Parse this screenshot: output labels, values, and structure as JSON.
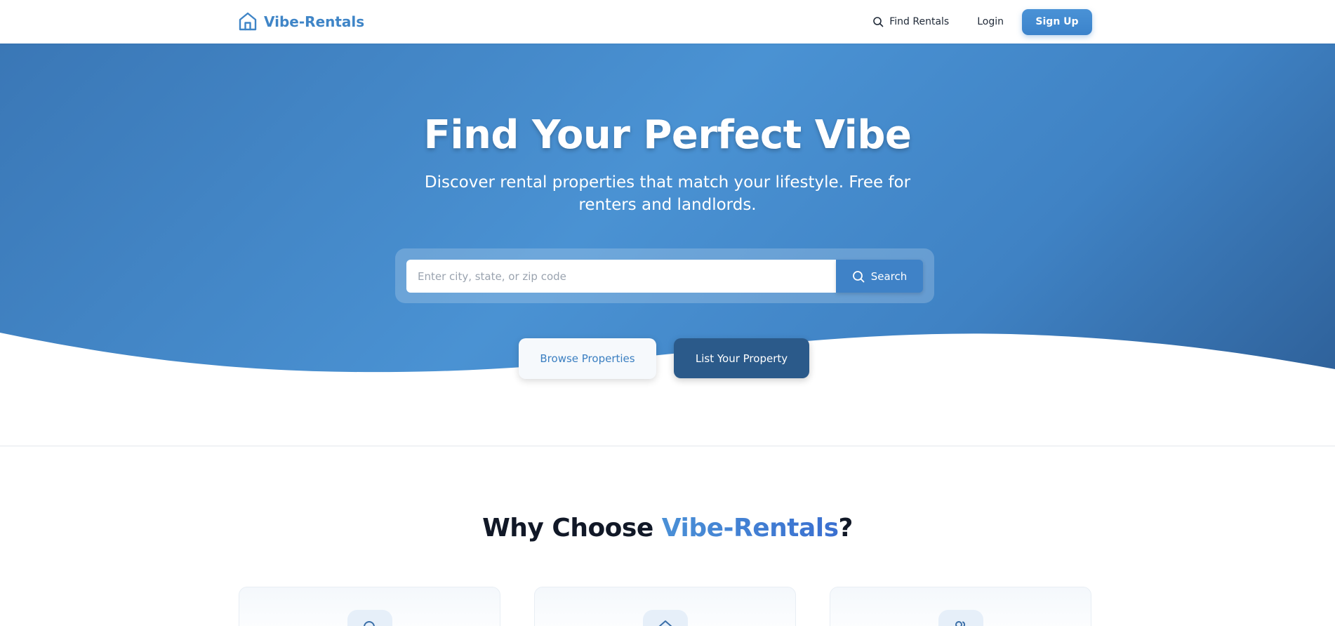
{
  "brand": {
    "name": "Vibe-Rentals",
    "icon": "home-icon"
  },
  "nav": {
    "find_rentals": "Find Rentals",
    "find_icon": "search-icon",
    "login": "Login",
    "signup": "Sign Up"
  },
  "hero": {
    "title": "Find Your Perfect Vibe",
    "subtitle": "Discover rental properties that match your lifestyle. Free for renters and landlords.",
    "search": {
      "placeholder": "Enter city, state, or zip code",
      "value": "",
      "button": "Search",
      "button_icon": "search-icon"
    },
    "browse_button": "Browse Properties",
    "list_button": "List Your Property"
  },
  "why": {
    "title_prefix": "Why Choose ",
    "title_accent": "Vibe-Rentals",
    "title_suffix": "?"
  },
  "features": [
    {
      "icon": "search-icon"
    },
    {
      "icon": "home-icon"
    },
    {
      "icon": "users-icon"
    }
  ],
  "colors": {
    "brand": "#3f85c7",
    "hero_start": "#3a77b6",
    "hero_end": "#2d5e96",
    "secondary_button": "#2b5a8a",
    "heading": "#111827"
  }
}
